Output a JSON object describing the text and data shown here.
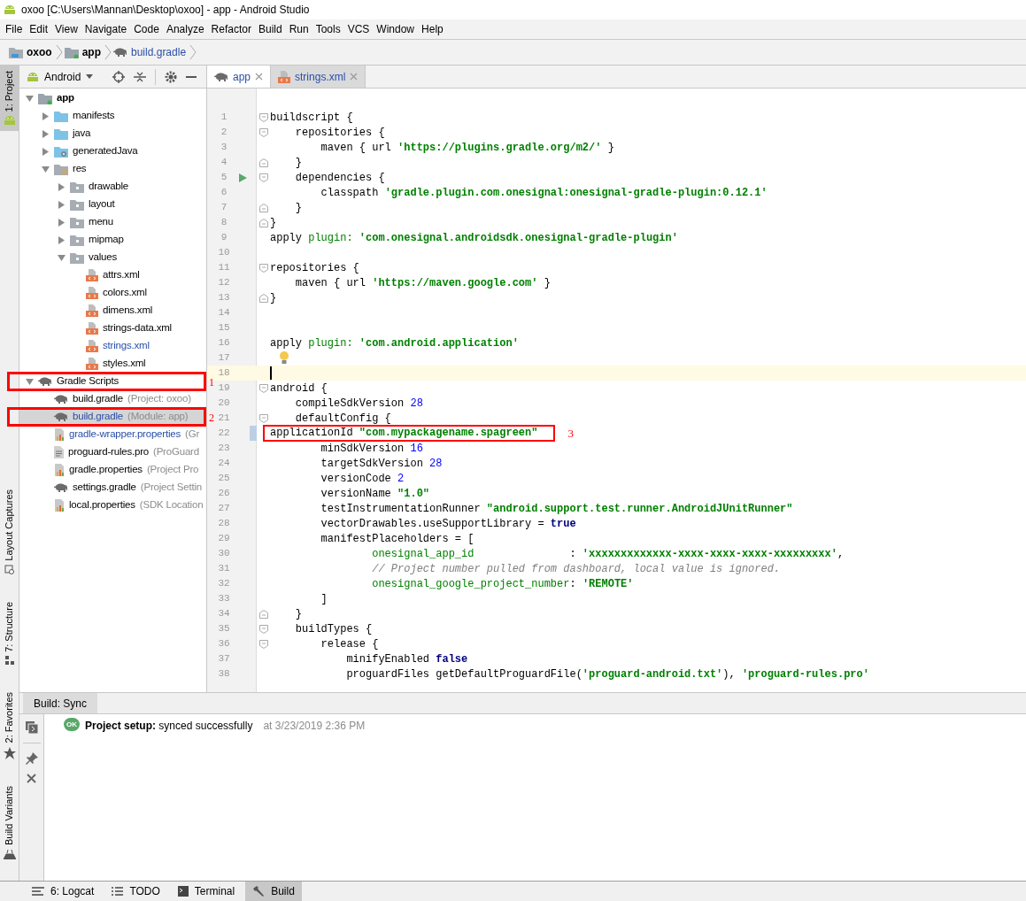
{
  "window": {
    "title": "oxoo [C:\\Users\\Mannan\\Desktop\\oxoo] - app - Android Studio"
  },
  "menu": [
    "File",
    "Edit",
    "View",
    "Navigate",
    "Code",
    "Analyze",
    "Refactor",
    "Build",
    "Run",
    "Tools",
    "VCS",
    "Window",
    "Help"
  ],
  "breadcrumb": [
    {
      "label": "oxoo",
      "kind": "project"
    },
    {
      "label": "app",
      "kind": "module"
    },
    {
      "label": "build.gradle",
      "kind": "gradle"
    }
  ],
  "left_strip": {
    "top": [
      {
        "label": "1: Project",
        "kind": "android",
        "selected": true
      }
    ],
    "bottom": [
      {
        "label": "Layout Captures",
        "kind": "captures",
        "selected": false
      },
      {
        "label": "7: Structure",
        "kind": "structure",
        "selected": false
      },
      {
        "label": "2: Favorites",
        "kind": "star",
        "selected": false
      },
      {
        "label": "Build Variants",
        "kind": "variants",
        "selected": false
      }
    ]
  },
  "project_panel": {
    "view": "Android",
    "tree": [
      {
        "label": "app",
        "kind": "module",
        "bold": true,
        "expanded": true,
        "children": [
          {
            "label": "manifests",
            "kind": "folder-blue",
            "expanded": false
          },
          {
            "label": "java",
            "kind": "folder-blue",
            "expanded": false
          },
          {
            "label": "generatedJava",
            "kind": "folder-gen",
            "expanded": false
          },
          {
            "label": "res",
            "kind": "folder-res",
            "expanded": true,
            "children": [
              {
                "label": "drawable",
                "kind": "folder",
                "expanded": false
              },
              {
                "label": "layout",
                "kind": "folder",
                "expanded": false
              },
              {
                "label": "menu",
                "kind": "folder",
                "expanded": false
              },
              {
                "label": "mipmap",
                "kind": "folder",
                "expanded": false
              },
              {
                "label": "values",
                "kind": "folder",
                "expanded": true,
                "children": [
                  {
                    "label": "attrs.xml",
                    "kind": "xml",
                    "modified": false
                  },
                  {
                    "label": "colors.xml",
                    "kind": "xml",
                    "modified": false
                  },
                  {
                    "label": "dimens.xml",
                    "kind": "xml",
                    "modified": false
                  },
                  {
                    "label": "strings-data.xml",
                    "kind": "xml",
                    "modified": false
                  },
                  {
                    "label": "strings.xml",
                    "kind": "xml",
                    "modified": true
                  },
                  {
                    "label": "styles.xml",
                    "kind": "xml",
                    "modified": false
                  }
                ]
              }
            ]
          }
        ]
      },
      {
        "label": "Gradle Scripts",
        "kind": "gradle",
        "expanded": true,
        "annotation": "1",
        "children": [
          {
            "label": "build.gradle",
            "hint": "(Project: oxoo)",
            "kind": "gradle",
            "modified": false,
            "selected": false
          },
          {
            "label": "build.gradle",
            "hint": "(Module: app)",
            "kind": "gradle",
            "modified": true,
            "selected": true,
            "annotation": "2"
          },
          {
            "label": "gradle-wrapper.properties",
            "hint": "(Gr",
            "kind": "properties",
            "modified": true,
            "selected": false
          },
          {
            "label": "proguard-rules.pro",
            "hint": "(ProGuard",
            "kind": "text",
            "modified": false,
            "selected": false
          },
          {
            "label": "gradle.properties",
            "hint": "(Project Pro",
            "kind": "properties",
            "modified": false,
            "selected": false
          },
          {
            "label": "settings.gradle",
            "hint": "(Project Settin",
            "kind": "gradle",
            "modified": false,
            "selected": false
          },
          {
            "label": "local.properties",
            "hint": "(SDK Location",
            "kind": "properties",
            "modified": false,
            "selected": false
          }
        ]
      }
    ]
  },
  "editor_tabs": [
    {
      "label": "app",
      "kind": "gradle",
      "selected": true
    },
    {
      "label": "strings.xml",
      "kind": "xml",
      "selected": false
    }
  ],
  "code_lines": [
    {
      "number": "1",
      "fold_start": true,
      "tokens": [
        {
          "kind": "plain",
          "text": "buildscript {"
        }
      ]
    },
    {
      "number": "2",
      "fold_start": true,
      "tokens": [
        {
          "kind": "plain",
          "text": "    repositories {"
        }
      ]
    },
    {
      "number": "3",
      "tokens": [
        {
          "kind": "plain",
          "text": "        maven { url "
        },
        {
          "kind": "string",
          "text": "'https://plugins.gradle.org/m2/'"
        },
        {
          "kind": "plain",
          "text": " }"
        }
      ]
    },
    {
      "number": "4",
      "fold_end": true,
      "tokens": [
        {
          "kind": "plain",
          "text": "    }"
        }
      ]
    },
    {
      "number": "5",
      "fold_start": true,
      "run_marker": true,
      "tokens": [
        {
          "kind": "plain",
          "text": "    dependencies {"
        }
      ]
    },
    {
      "number": "6",
      "tokens": [
        {
          "kind": "plain",
          "text": "        classpath "
        },
        {
          "kind": "string",
          "text": "'gradle.plugin.com.onesignal:onesignal-gradle-plugin:0.12.1'"
        }
      ]
    },
    {
      "number": "7",
      "fold_end": true,
      "tokens": [
        {
          "kind": "plain",
          "text": "    }"
        }
      ]
    },
    {
      "number": "8",
      "fold_end": true,
      "tokens": [
        {
          "kind": "plain",
          "text": "}"
        }
      ]
    },
    {
      "number": "9",
      "tokens": [
        {
          "kind": "plain",
          "text": "apply "
        },
        {
          "kind": "key",
          "text": "plugin:"
        },
        {
          "kind": "string",
          "text": " 'com.onesignal.androidsdk.onesignal-gradle-plugin'"
        }
      ]
    },
    {
      "number": "10"
    },
    {
      "number": "11",
      "fold_start": true,
      "tokens": [
        {
          "kind": "plain",
          "text": "repositories {"
        }
      ]
    },
    {
      "number": "12",
      "tokens": [
        {
          "kind": "plain",
          "text": "    maven { url "
        },
        {
          "kind": "string",
          "text": "'https://maven.google.com'"
        },
        {
          "kind": "plain",
          "text": " }"
        }
      ]
    },
    {
      "number": "13",
      "fold_end": true,
      "tokens": [
        {
          "kind": "plain",
          "text": "}"
        }
      ]
    },
    {
      "number": "14"
    },
    {
      "number": "15"
    },
    {
      "number": "16",
      "tokens": [
        {
          "kind": "plain",
          "text": "apply "
        },
        {
          "kind": "key",
          "text": "plugin:"
        },
        {
          "kind": "string",
          "text": " 'com.android.application'"
        }
      ]
    },
    {
      "number": "17",
      "bulb": true
    },
    {
      "number": "18",
      "current": true
    },
    {
      "number": "19",
      "fold_start": true,
      "tokens": [
        {
          "kind": "plain",
          "text": "android {"
        }
      ]
    },
    {
      "number": "20",
      "tokens": [
        {
          "kind": "plain",
          "text": "    compileSdkVersion "
        },
        {
          "kind": "number",
          "text": "28"
        }
      ]
    },
    {
      "number": "21",
      "fold_start": true,
      "tokens": [
        {
          "kind": "plain",
          "text": "    defaultConfig {"
        }
      ]
    },
    {
      "number": "22",
      "changed": true,
      "annotation": "3",
      "tokens": [
        {
          "kind": "plain",
          "text": "        applicationId "
        },
        {
          "kind": "string",
          "text": "\"com.mypackagename.spagreen\""
        }
      ]
    },
    {
      "number": "23",
      "tokens": [
        {
          "kind": "plain",
          "text": "        minSdkVersion "
        },
        {
          "kind": "number",
          "text": "16"
        }
      ]
    },
    {
      "number": "24",
      "tokens": [
        {
          "kind": "plain",
          "text": "        targetSdkVersion "
        },
        {
          "kind": "number",
          "text": "28"
        }
      ]
    },
    {
      "number": "25",
      "tokens": [
        {
          "kind": "plain",
          "text": "        versionCode "
        },
        {
          "kind": "number",
          "text": "2"
        }
      ]
    },
    {
      "number": "26",
      "tokens": [
        {
          "kind": "plain",
          "text": "        versionName "
        },
        {
          "kind": "string",
          "text": "\"1.0\""
        }
      ]
    },
    {
      "number": "27",
      "tokens": [
        {
          "kind": "plain",
          "text": "        testInstrumentationRunner "
        },
        {
          "kind": "string",
          "text": "\"android.support.test.runner.AndroidJUnitRunner\""
        }
      ]
    },
    {
      "number": "28",
      "tokens": [
        {
          "kind": "plain",
          "text": "        vectorDrawables.useSupportLibrary = "
        },
        {
          "kind": "keyword",
          "text": "true"
        }
      ]
    },
    {
      "number": "29",
      "tokens": [
        {
          "kind": "plain",
          "text": "        manifestPlaceholders = ["
        }
      ]
    },
    {
      "number": "30",
      "tokens": [
        {
          "kind": "key",
          "text": "                onesignal_app_id"
        },
        {
          "kind": "plain",
          "text": "               : "
        },
        {
          "kind": "string",
          "text": "'xxxxxxxxxxxxx-xxxx-xxxx-xxxx-xxxxxxxxx'"
        },
        {
          "kind": "plain",
          "text": ","
        }
      ]
    },
    {
      "number": "31",
      "tokens": [
        {
          "kind": "comment",
          "text": "                // Project number pulled from dashboard, local value is ignored."
        }
      ]
    },
    {
      "number": "32",
      "tokens": [
        {
          "kind": "key",
          "text": "                onesignal_google_project_number"
        },
        {
          "kind": "plain",
          "text": ": "
        },
        {
          "kind": "string",
          "text": "'REMOTE'"
        }
      ]
    },
    {
      "number": "33",
      "tokens": [
        {
          "kind": "plain",
          "text": "        ]"
        }
      ]
    },
    {
      "number": "34",
      "fold_end": true,
      "tokens": [
        {
          "kind": "plain",
          "text": "    }"
        }
      ]
    },
    {
      "number": "35",
      "fold_start": true,
      "tokens": [
        {
          "kind": "plain",
          "text": "    buildTypes {"
        }
      ]
    },
    {
      "number": "36",
      "fold_start": true,
      "tokens": [
        {
          "kind": "plain",
          "text": "        release {"
        }
      ]
    },
    {
      "number": "37",
      "tokens": [
        {
          "kind": "plain",
          "text": "            minifyEnabled "
        },
        {
          "kind": "keyword",
          "text": "false"
        }
      ]
    },
    {
      "number": "38",
      "tokens": [
        {
          "kind": "plain",
          "text": "            proguardFiles getDefaultProguardFile("
        },
        {
          "kind": "string",
          "text": "'proguard-android.txt'"
        },
        {
          "kind": "plain",
          "text": "), "
        },
        {
          "kind": "string",
          "text": "'proguard-rules.pro'"
        }
      ]
    }
  ],
  "build_panel": {
    "tab": "Build: Sync",
    "status_badge": "OK",
    "message": "**Project setup:** synced successfully",
    "time": "at 3/23/2019 2:36 PM"
  },
  "bottom_tools": [
    {
      "label": "6: Logcat",
      "kind": "logcat",
      "selected": false
    },
    {
      "label": "TODO",
      "kind": "todo",
      "selected": false
    },
    {
      "label": "Terminal",
      "kind": "terminal",
      "selected": false
    },
    {
      "label": "Build",
      "kind": "hammer",
      "selected": true
    }
  ]
}
